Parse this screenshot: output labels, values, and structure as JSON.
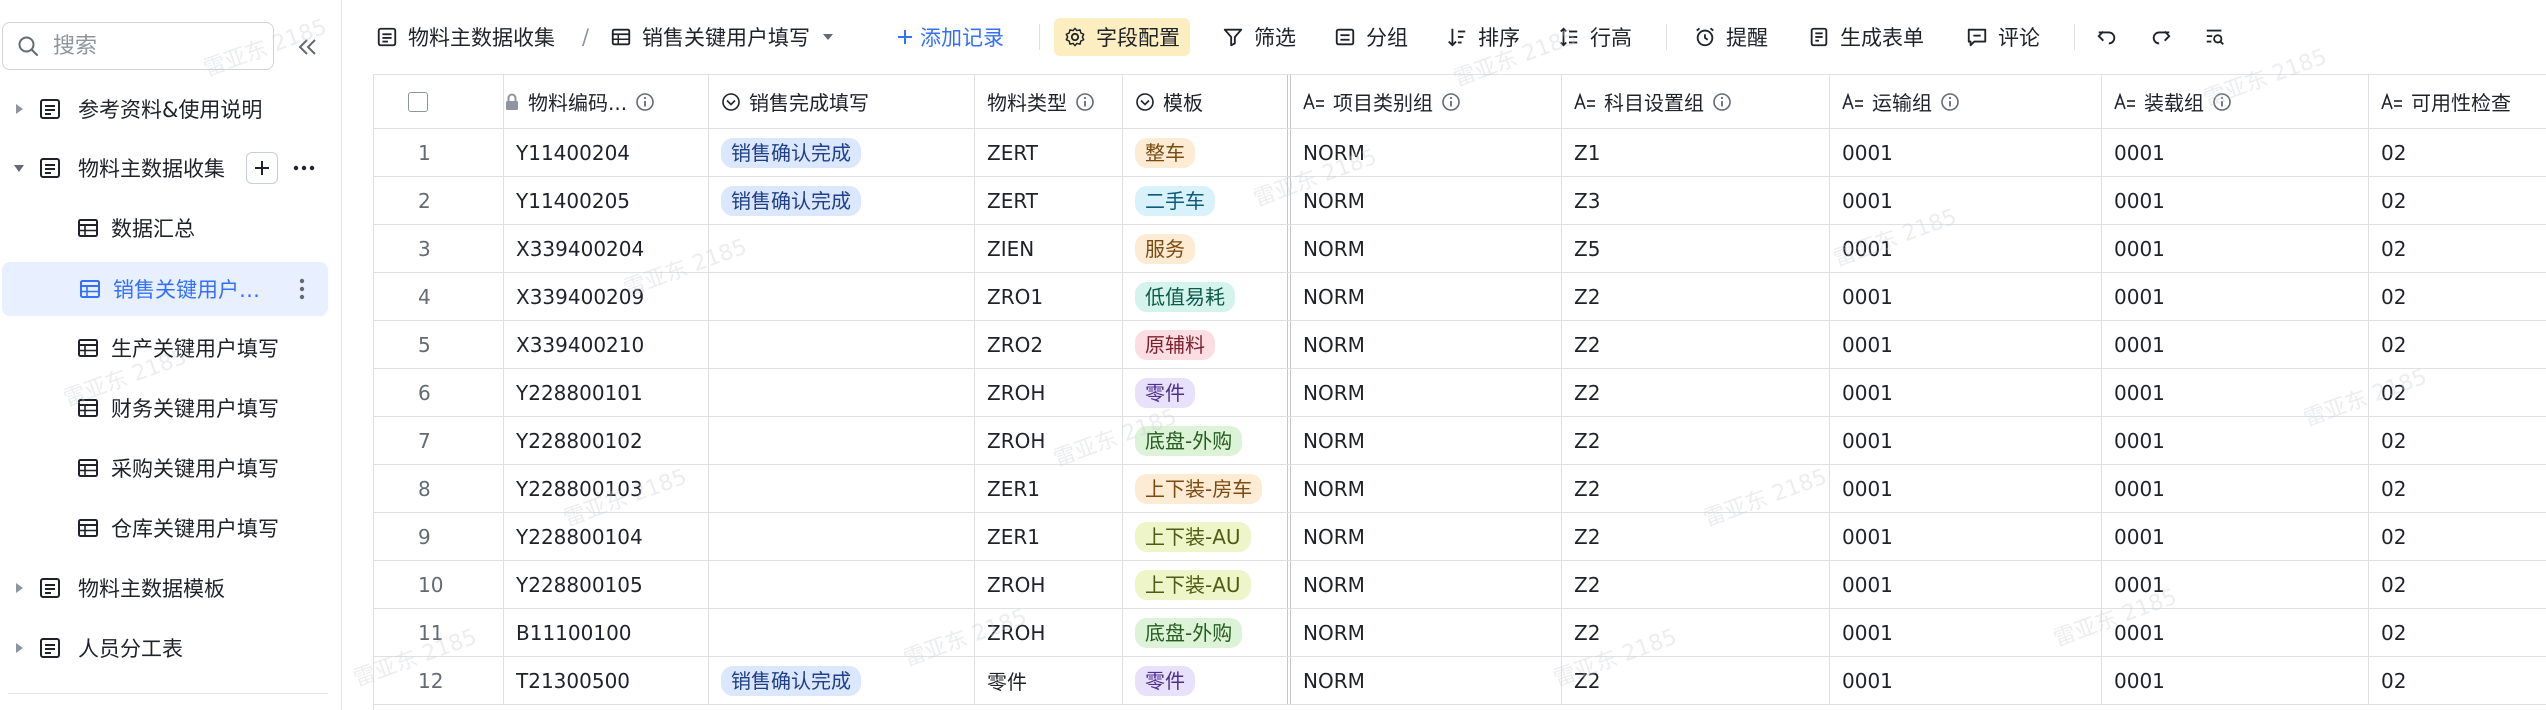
{
  "sidebar": {
    "search_placeholder": "搜索",
    "items": [
      {
        "label": "参考资料&使用说明"
      },
      {
        "label": "物料主数据收集"
      },
      {
        "label": "数据汇总"
      },
      {
        "label": "销售关键用户填写"
      },
      {
        "label": "生产关键用户填写"
      },
      {
        "label": "财务关键用户填写"
      },
      {
        "label": "采购关键用户填写"
      },
      {
        "label": "仓库关键用户填写"
      },
      {
        "label": "物料主数据模板"
      },
      {
        "label": "人员分工表"
      }
    ]
  },
  "toolbar": {
    "breadcrumb_parent": "物料主数据收集",
    "breadcrumb_sep": "/",
    "breadcrumb_current": "销售关键用户填写",
    "add_record": "添加记录",
    "field_config": "字段配置",
    "filter": "筛选",
    "group": "分组",
    "sort": "排序",
    "row_height": "行高",
    "reminder": "提醒",
    "generate_form": "生成表单",
    "comment": "评论"
  },
  "grid": {
    "columns": [
      "物料编码...",
      "销售完成填写",
      "物料类型",
      "模板",
      "项目类别组",
      "科目设置组",
      "运输组",
      "装载组",
      "可用性检查"
    ],
    "rows": [
      {
        "no": "1",
        "code": "Y11400204",
        "sales": "销售确认完成",
        "mtype": "ZERT",
        "tpl": "整车",
        "tplColor": "#fdebd3",
        "tplText": "#7a4a12",
        "itemcat": "NORM",
        "acct": "Z1",
        "trans": "0001",
        "load": "0001",
        "avail": "02"
      },
      {
        "no": "2",
        "code": "Y11400205",
        "sales": "销售确认完成",
        "mtype": "ZERT",
        "tpl": "二手车",
        "tplColor": "#d9f1fb",
        "tplText": "#0b5a7a",
        "itemcat": "NORM",
        "acct": "Z3",
        "trans": "0001",
        "load": "0001",
        "avail": "02"
      },
      {
        "no": "3",
        "code": "X339400204",
        "sales": "",
        "mtype": "ZIEN",
        "tpl": "服务",
        "tplColor": "#fdebd3",
        "tplText": "#7a4a12",
        "itemcat": "NORM",
        "acct": "Z5",
        "trans": "0001",
        "load": "0001",
        "avail": "02"
      },
      {
        "no": "4",
        "code": "X339400209",
        "sales": "",
        "mtype": "ZRO1",
        "tpl": "低值易耗",
        "tplColor": "#d3f3ec",
        "tplText": "#0e5a4a",
        "itemcat": "NORM",
        "acct": "Z2",
        "trans": "0001",
        "load": "0001",
        "avail": "02"
      },
      {
        "no": "5",
        "code": "X339400210",
        "sales": "",
        "mtype": "ZRO2",
        "tpl": "原辅料",
        "tplColor": "#fcdee2",
        "tplText": "#7a1f2c",
        "itemcat": "NORM",
        "acct": "Z2",
        "trans": "0001",
        "load": "0001",
        "avail": "02"
      },
      {
        "no": "6",
        "code": "Y228800101",
        "sales": "",
        "mtype": "ZROH",
        "tpl": "零件",
        "tplColor": "#e8e1fb",
        "tplText": "#4b2e8f",
        "itemcat": "NORM",
        "acct": "Z2",
        "trans": "0001",
        "load": "0001",
        "avail": "02"
      },
      {
        "no": "7",
        "code": "Y228800102",
        "sales": "",
        "mtype": "ZROH",
        "tpl": "底盘-外购",
        "tplColor": "#dcf3d8",
        "tplText": "#265c1f",
        "itemcat": "NORM",
        "acct": "Z2",
        "trans": "0001",
        "load": "0001",
        "avail": "02"
      },
      {
        "no": "8",
        "code": "Y228800103",
        "sales": "",
        "mtype": "ZER1",
        "tpl": "上下装-房车",
        "tplColor": "#fdebd3",
        "tplText": "#7a4a12",
        "itemcat": "NORM",
        "acct": "Z2",
        "trans": "0001",
        "load": "0001",
        "avail": "02"
      },
      {
        "no": "9",
        "code": "Y228800104",
        "sales": "",
        "mtype": "ZER1",
        "tpl": "上下装-AU",
        "tplColor": "#eef5c9",
        "tplText": "#4f5c12",
        "itemcat": "NORM",
        "acct": "Z2",
        "trans": "0001",
        "load": "0001",
        "avail": "02"
      },
      {
        "no": "10",
        "code": "Y228800105",
        "sales": "",
        "mtype": "ZROH",
        "tpl": "上下装-AU",
        "tplColor": "#eef5c9",
        "tplText": "#4f5c12",
        "itemcat": "NORM",
        "acct": "Z2",
        "trans": "0001",
        "load": "0001",
        "avail": "02"
      },
      {
        "no": "11",
        "code": "B11100100",
        "sales": "",
        "mtype": "ZROH",
        "tpl": "底盘-外购",
        "tplColor": "#dcf3d8",
        "tplText": "#265c1f",
        "itemcat": "NORM",
        "acct": "Z2",
        "trans": "0001",
        "load": "0001",
        "avail": "02"
      },
      {
        "no": "12",
        "code": "T21300500",
        "sales": "销售确认完成",
        "mtype": "零件",
        "tpl": "零件",
        "tplColor": "#e8e1fb",
        "tplText": "#4b2e8f",
        "itemcat": "NORM",
        "acct": "Z2",
        "trans": "0001",
        "load": "0001",
        "avail": "02"
      }
    ],
    "sales_tag_color": "#dbe7fd",
    "sales_tag_text": "#1f3f8a"
  },
  "watermark": "雷亚东 2185"
}
